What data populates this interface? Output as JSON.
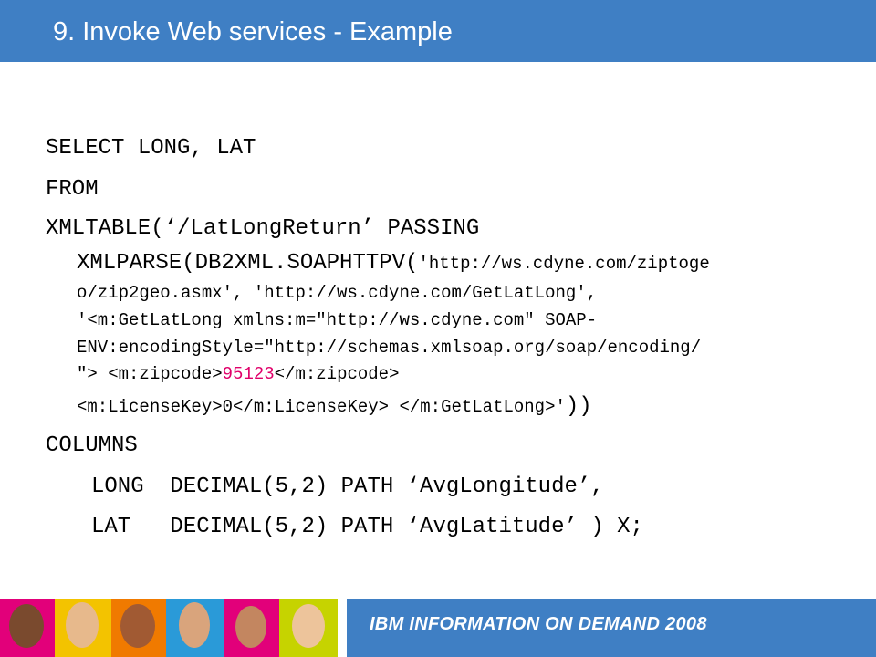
{
  "header": {
    "title": "9. Invoke Web services - Example"
  },
  "code": {
    "l1": "SELECT LONG, LAT",
    "l2": "FROM",
    "l3": "XMLTABLE(‘/LatLongReturn’ PASSING",
    "l4a": "XMLPARSE(DB2XML.SOAPHTTPV(",
    "l4b": "'http://ws.cdyne.com/ziptoge",
    "l5": "o/zip2geo.asmx', 'http://ws.cdyne.com/GetLatLong',",
    "l6": "'<m:GetLatLong xmlns:m=\"http://ws.cdyne.com\" SOAP-",
    "l7": "ENV:encodingStyle=\"http://schemas.xmlsoap.org/soap/encoding/",
    "l8a": "\"> <m:zipcode>",
    "l8b": "95123",
    "l8c": "</m:zipcode>",
    "l9a": "<m:LicenseKey>0</m:LicenseKey> </m:GetLatLong>'",
    "l9b": "))",
    "l10": "COLUMNS",
    "l11": "LONG  DECIMAL(5,2) PATH ‘AvgLongitude’,",
    "l12": "LAT   DECIMAL(5,2) PATH ‘AvgLatitude’ ) X;"
  },
  "footer": {
    "brand": "IBM INFORMATION ON DEMAND 2008"
  },
  "colors": {
    "header_bg": "#3f7fc4",
    "highlight": "#e0006a"
  }
}
